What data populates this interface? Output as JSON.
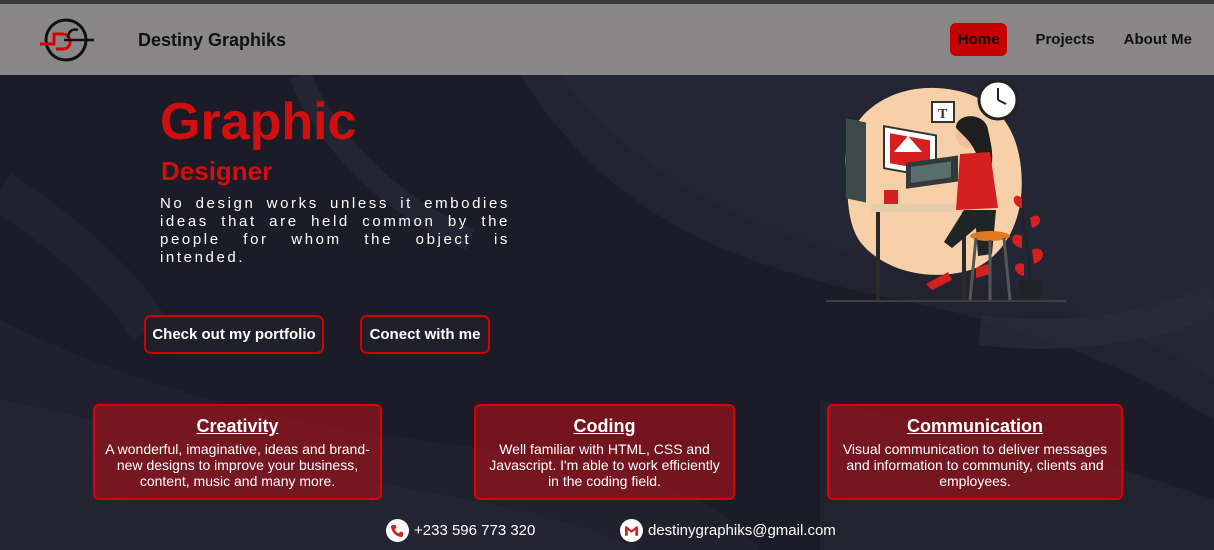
{
  "header": {
    "brand": "Destiny Graphiks",
    "nav": [
      {
        "label": "Home",
        "active": true
      },
      {
        "label": "Projects",
        "active": false
      },
      {
        "label": "About Me",
        "active": false
      }
    ]
  },
  "hero": {
    "title": "Graphic",
    "subtitle": "Designer",
    "quote": "No design works unless it embodies ideas that are held common by the people for whom the object is intended.",
    "buttons": {
      "portfolio": "Check out my portfolio",
      "connect": "Conect with me"
    }
  },
  "cards": [
    {
      "title": "Creativity",
      "text": "A wonderful, imaginative, ideas and brand-new designs to improve your business, content, music and many more."
    },
    {
      "title": "Coding",
      "text": "Well familiar with HTML, CSS and Javascript. I'm able to work efficiently in the coding field."
    },
    {
      "title": "Communication",
      "text": "Visual communication to deliver messages and information to community, clients and employees."
    }
  ],
  "contact": {
    "phone": "+233 596 773 320",
    "email": "destinygraphiks@gmail.com"
  },
  "colors": {
    "accent": "#d10f0f",
    "navbar": "#8a8789",
    "background": "#1b1c27",
    "card": "#96121c"
  },
  "icons": {
    "logo": "dg-logo",
    "phone": "phone-icon",
    "email": "gmail-icon"
  }
}
